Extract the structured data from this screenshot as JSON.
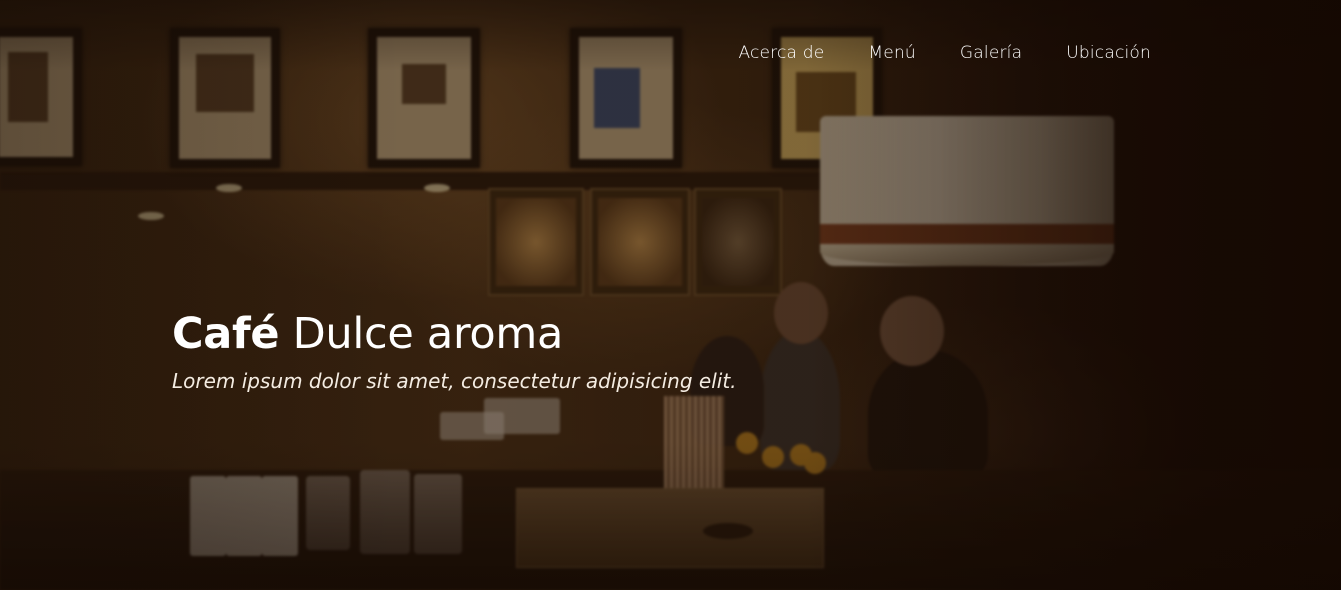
{
  "nav": {
    "items": [
      {
        "label": "Acerca de"
      },
      {
        "label": "Menú"
      },
      {
        "label": "Galería"
      },
      {
        "label": "Ubicación"
      }
    ]
  },
  "hero": {
    "title_bold": "Café",
    "title_light": "Dulce aroma",
    "subtitle": "Lorem ipsum dolor sit amet, consectetur adipisicing elit."
  },
  "colors": {
    "overlay": "#1e0f06",
    "text": "#ffffff"
  }
}
